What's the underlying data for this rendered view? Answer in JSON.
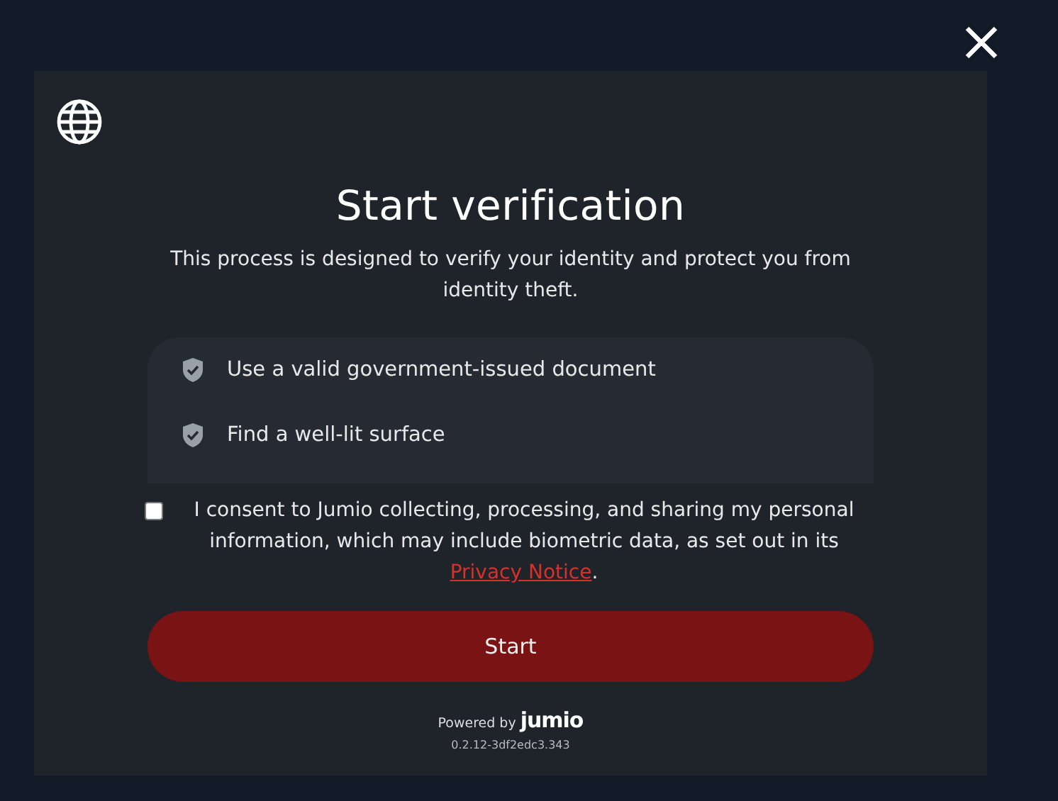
{
  "dialog": {
    "title": "Start verification",
    "description": "This process is designed to verify your identity and protect you from identity theft.",
    "requirements": [
      {
        "label": "Use a valid government-issued document"
      },
      {
        "label": "Find a well-lit surface"
      }
    ],
    "consent": {
      "checked": false,
      "text": "I consent to Jumio collecting, processing, and sharing my personal information, which may include biometric data, as set out in its",
      "link": "Privacy Notice",
      "after": "."
    },
    "start_button": "Start",
    "footer": {
      "powered_by": "Powered by",
      "brand": "jumio",
      "version": "0.2.12-3df2edc3.343"
    }
  }
}
